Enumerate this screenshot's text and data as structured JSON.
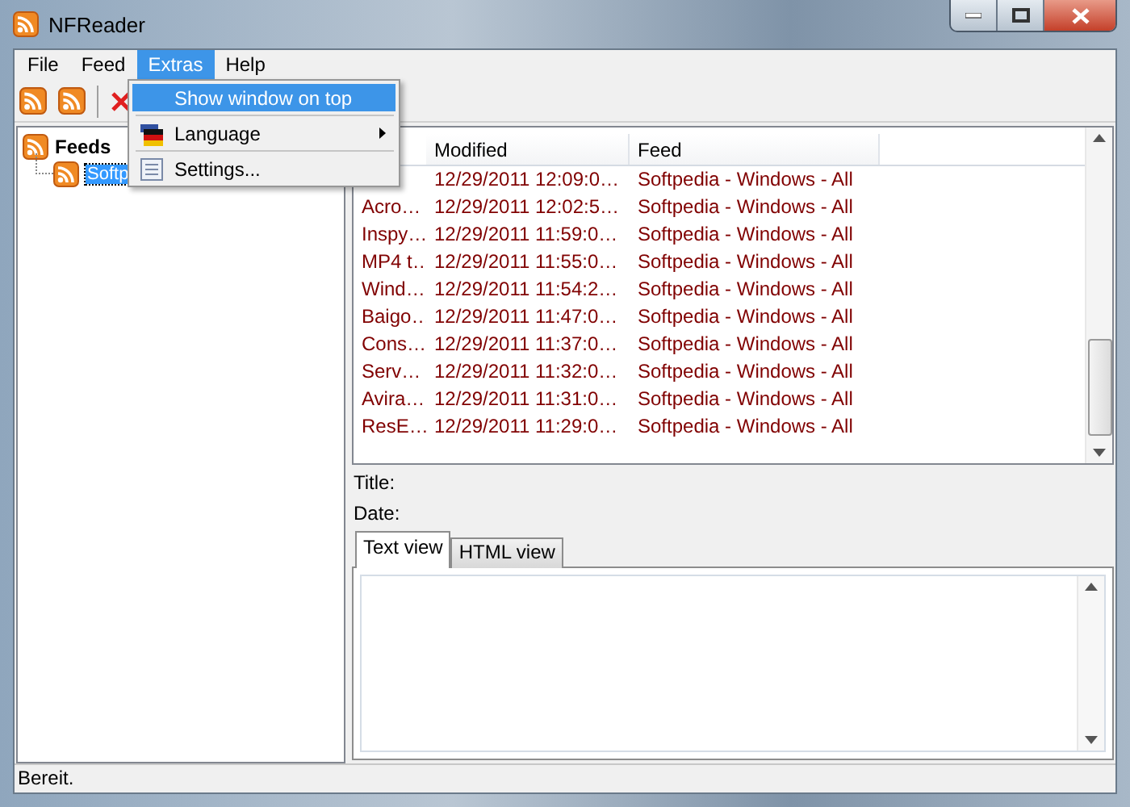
{
  "window": {
    "title": "NFReader"
  },
  "menu_bar": [
    {
      "label": "File",
      "selected": false
    },
    {
      "label": "Feed",
      "selected": false
    },
    {
      "label": "Extras",
      "selected": true
    },
    {
      "label": "Help",
      "selected": false
    }
  ],
  "dropdown_menu": [
    {
      "kind": "item",
      "label": "Show window on top",
      "selected": true
    },
    {
      "kind": "separator"
    },
    {
      "kind": "submenu",
      "label": "Language",
      "selected": false
    },
    {
      "kind": "separator"
    },
    {
      "kind": "item",
      "label": "Settings...",
      "selected": false
    }
  ],
  "tree": {
    "label": "Feeds",
    "children": [
      {
        "label": "Softp",
        "selected": true
      }
    ]
  },
  "feed_list": {
    "columns": [
      {
        "label": "Modified"
      },
      {
        "label": "Feed"
      }
    ],
    "rows": [
      {
        "modified": "12/29/2011 12:09:0…",
        "feed": "Softpedia - Windows - All"
      },
      {
        "title": "Acro…",
        "modified": "12/29/2011 12:02:5…",
        "feed": "Softpedia - Windows - All"
      },
      {
        "title": "Inspy…",
        "modified": "12/29/2011 11:59:0…",
        "feed": "Softpedia - Windows - All"
      },
      {
        "title": "MP4 t…",
        "modified": "12/29/2011 11:55:0…",
        "feed": "Softpedia - Windows - All"
      },
      {
        "title": "Wind…",
        "modified": "12/29/2011 11:54:2…",
        "feed": "Softpedia - Windows - All"
      },
      {
        "title": "Baigo…",
        "modified": "12/29/2011 11:47:0…",
        "feed": "Softpedia - Windows - All"
      },
      {
        "title": "Cons…",
        "modified": "12/29/2011 11:37:0…",
        "feed": "Softpedia - Windows - All"
      },
      {
        "title": "Serv…",
        "modified": "12/29/2011 11:32:0…",
        "feed": "Softpedia - Windows - All"
      },
      {
        "title": "Avira…",
        "modified": "12/29/2011 11:31:0…",
        "feed": "Softpedia - Windows - All"
      },
      {
        "title": "ResE…",
        "modified": "12/29/2011 11:29:0…",
        "feed": "Softpedia - Windows - All"
      }
    ]
  },
  "detail": {
    "title_label": "Title:",
    "date_label": "Date:"
  },
  "tabs": [
    {
      "label": "Text view",
      "selected": true
    },
    {
      "label": "HTML view",
      "selected": false
    }
  ],
  "status_bar": "Bereit."
}
